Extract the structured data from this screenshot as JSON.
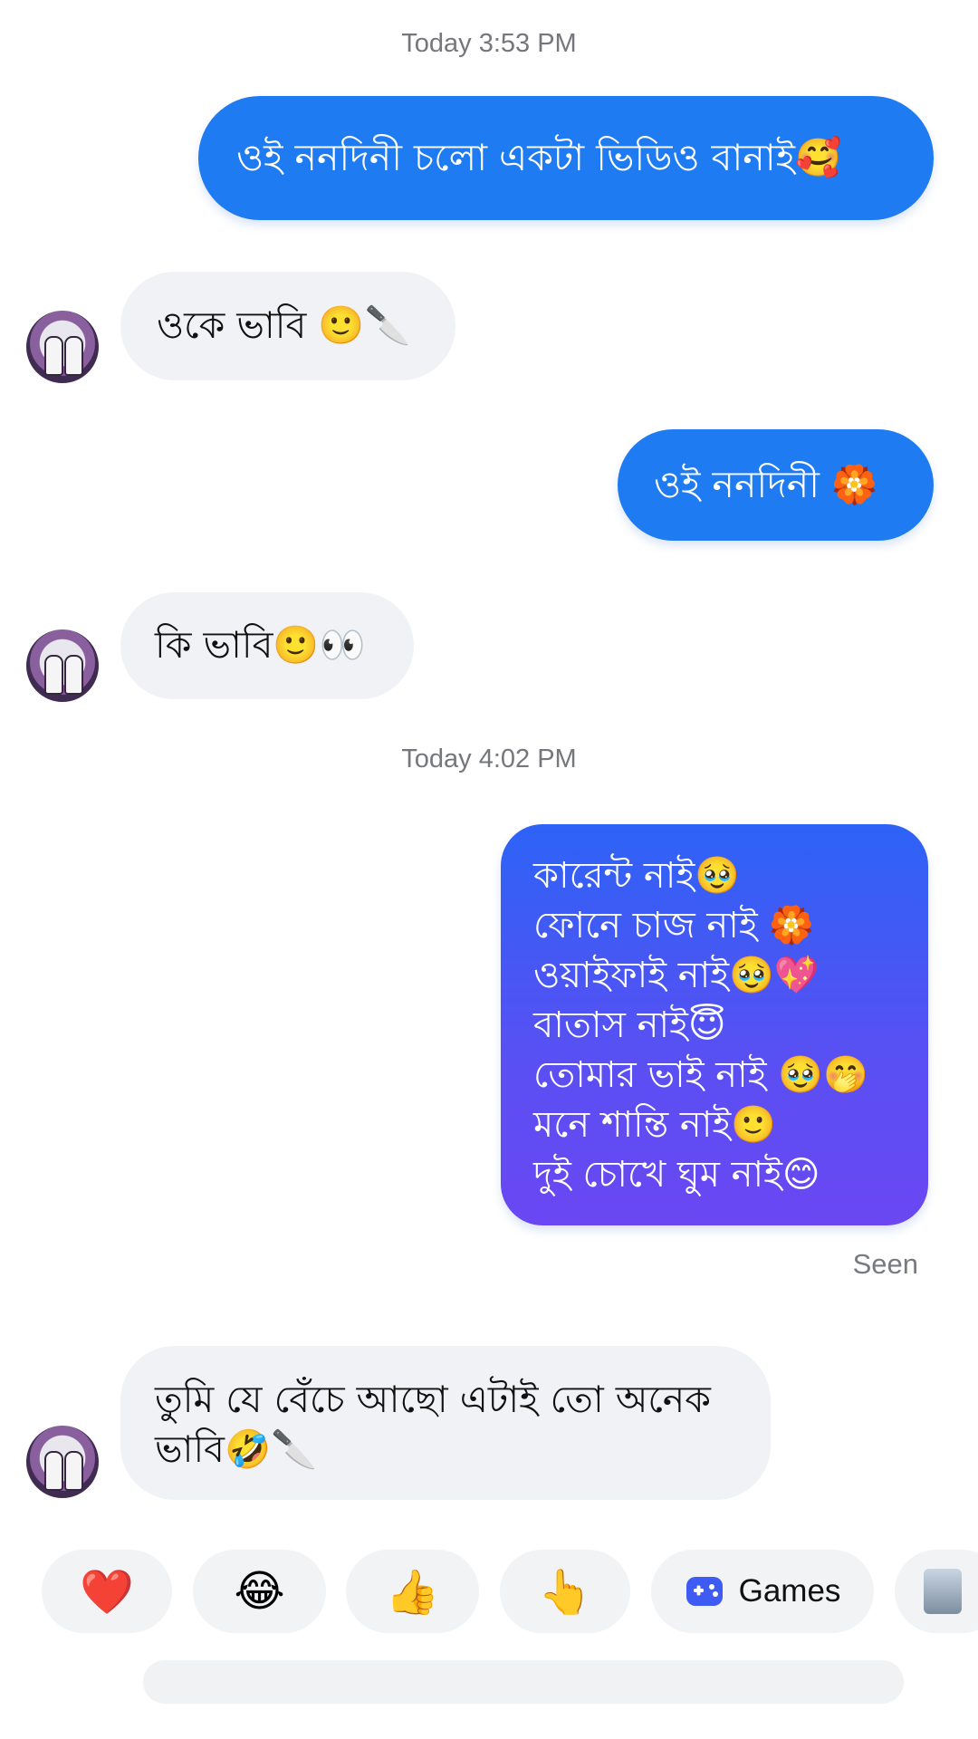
{
  "timestamps": [
    "Today 3:53 PM",
    "Today 4:02 PM"
  ],
  "messages": [
    {
      "dir": "out",
      "text": "ওই ননদিনী  চলো একটা ভিডিও  বানাই🥰"
    },
    {
      "dir": "in",
      "text": "ওকে ভাবি 🙂🔪"
    },
    {
      "dir": "out",
      "text": "ওই ননদিনী 🏵️"
    },
    {
      "dir": "in",
      "text": "কি ভাবি🙂👀"
    },
    {
      "dir": "out",
      "text": "কারেন্ট  নাই🥹\nফোনে চাজ নাই 🏵️\nওয়াইফাই নাই🥹💖\nবাতাস নাই😇\nতোমার ভাই নাই 🥹🤭\nমনে শান্তি নাই🙂\nদুই চোখে ঘুম নাই😊"
    },
    {
      "dir": "in",
      "text": "তুমি যে বেঁচে আছো এটাই তো অনেক\nভাবি🤣🔪"
    }
  ],
  "status": {
    "seen": "Seen"
  },
  "quick_replies": {
    "heart": "❤️",
    "laugh": "😂",
    "thumbs_up": "👍",
    "point": "👆",
    "games_label": "Games"
  },
  "colors": {
    "outgoing_bubble": "#1f7bf2",
    "outgoing_gradient_top": "#2d63f6",
    "outgoing_gradient_bottom": "#6a47f2",
    "incoming_bubble": "#f1f2f5",
    "games_icon": "#3e5bf3"
  },
  "icons": {
    "games": "gamepad-icon",
    "avatar": "contact-avatar"
  }
}
